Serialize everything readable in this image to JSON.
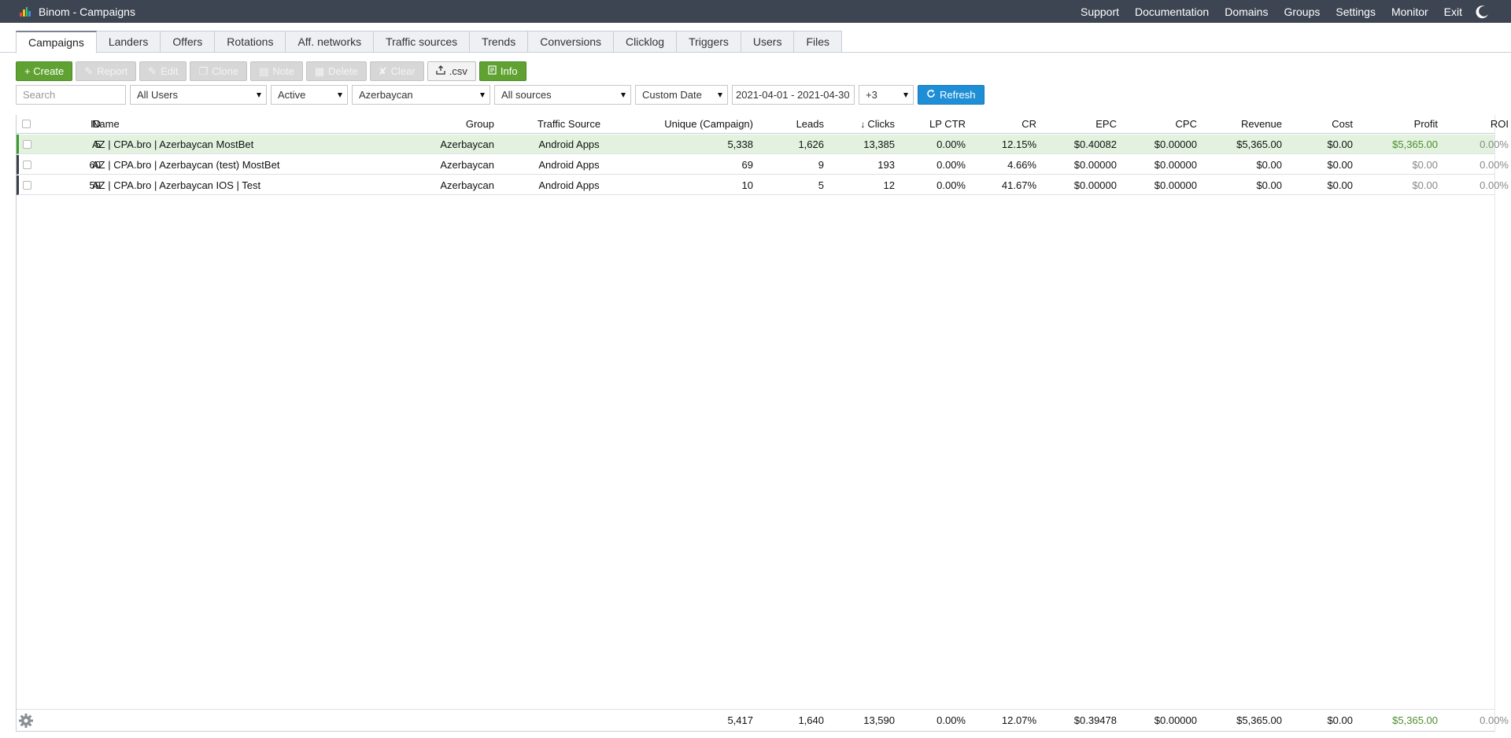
{
  "app": {
    "title": "Binom - Campaigns"
  },
  "topnav": [
    "Support",
    "Documentation",
    "Domains",
    "Groups",
    "Settings",
    "Monitor",
    "Exit"
  ],
  "tabs": [
    "Campaigns",
    "Landers",
    "Offers",
    "Rotations",
    "Aff. networks",
    "Traffic sources",
    "Trends",
    "Conversions",
    "Clicklog",
    "Triggers",
    "Users",
    "Files"
  ],
  "active_tab": "Campaigns",
  "toolbar": {
    "create": "+ Create",
    "report": "Report",
    "edit": "Edit",
    "clone": "Clone",
    "note": "Note",
    "delete": "Delete",
    "clear": "Clear",
    "csv": ".csv",
    "info": "Info"
  },
  "filters": {
    "search_placeholder": "Search",
    "users": "All Users",
    "status": "Active",
    "group": "Azerbaycan",
    "sources": "All sources",
    "date_mode": "Custom Date",
    "date_range": "2021-04-01 - 2021-04-30",
    "timezone": "+3",
    "refresh": "Refresh"
  },
  "table": {
    "columns": [
      "ID",
      "Name",
      "Group",
      "Traffic Source",
      "Unique (Campaign)",
      "Leads",
      "Clicks",
      "LP CTR",
      "CR",
      "EPC",
      "CPC",
      "Revenue",
      "Cost",
      "Profit",
      "ROI"
    ],
    "sorted_by": "Clicks",
    "rows": [
      {
        "id": "5",
        "name": "AZ | CPA.bro | Azerbaycan MostBet",
        "group": "Azerbaycan",
        "source": "Android Apps",
        "unique": "5,338",
        "leads": "1,626",
        "clicks": "13,385",
        "lpctr": "0.00%",
        "cr": "12.15%",
        "epc": "$0.40082",
        "cpc": "$0.00000",
        "revenue": "$5,365.00",
        "cost": "$0.00",
        "profit": "$5,365.00",
        "roi": "0.00%"
      },
      {
        "id": "60",
        "name": "AZ | CPA.bro | Azerbaycan (test) MostBet",
        "group": "Azerbaycan",
        "source": "Android Apps",
        "unique": "69",
        "leads": "9",
        "clicks": "193",
        "lpctr": "0.00%",
        "cr": "4.66%",
        "epc": "$0.00000",
        "cpc": "$0.00000",
        "revenue": "$0.00",
        "cost": "$0.00",
        "profit": "$0.00",
        "roi": "0.00%"
      },
      {
        "id": "59",
        "name": "AZ | CPA.bro | Azerbaycan IOS | Test",
        "group": "Azerbaycan",
        "source": "Android Apps",
        "unique": "10",
        "leads": "5",
        "clicks": "12",
        "lpctr": "0.00%",
        "cr": "41.67%",
        "epc": "$0.00000",
        "cpc": "$0.00000",
        "revenue": "$0.00",
        "cost": "$0.00",
        "profit": "$0.00",
        "roi": "0.00%"
      }
    ],
    "totals": {
      "unique": "5,417",
      "leads": "1,640",
      "clicks": "13,590",
      "lpctr": "0.00%",
      "cr": "12.07%",
      "epc": "$0.39478",
      "cpc": "$0.00000",
      "revenue": "$5,365.00",
      "cost": "$0.00",
      "profit": "$5,365.00",
      "roi": "0.00%"
    }
  },
  "colors": {
    "topbar": "#3d4452",
    "accent_green": "#5fa232",
    "accent_blue": "#1e8fd6",
    "profit_green": "#4b8d2c",
    "row_highlight": "#e2f2df"
  },
  "icons": {
    "logo": "bar-chart-logo",
    "theme": "moon-icon",
    "settings": "gear-icon",
    "refresh": "refresh-icon",
    "csv": "export-icon",
    "info": "info-icon"
  }
}
